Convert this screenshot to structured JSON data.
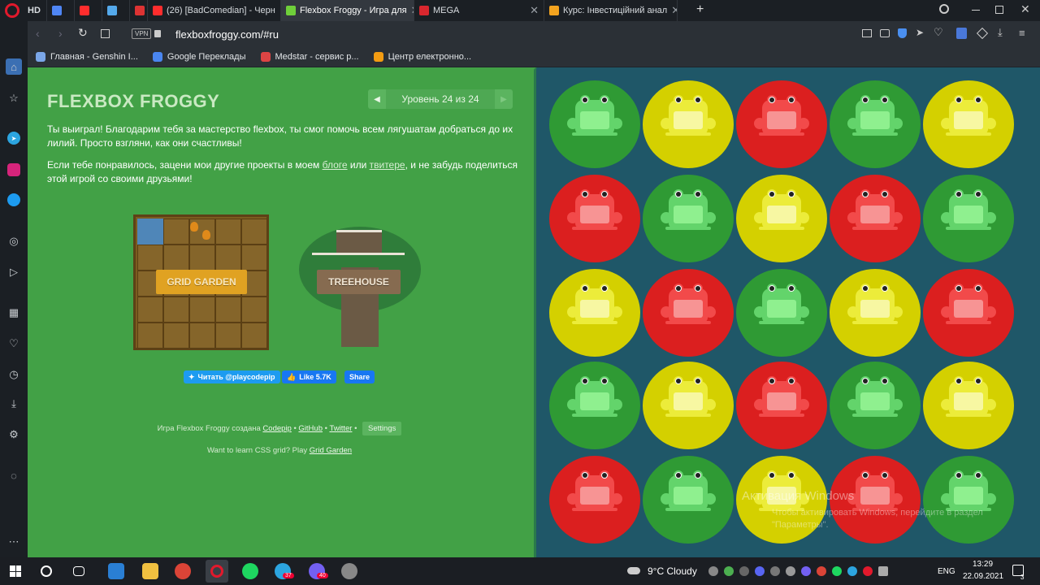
{
  "browser": {
    "tabs": [
      {
        "label": "HD",
        "color": "#3c3c3c"
      },
      {
        "label": "",
        "color": "#4f86f5"
      },
      {
        "label": "",
        "color": "#ff2d2d"
      },
      {
        "label": "",
        "color": "#54a9eb"
      },
      {
        "label": "",
        "color": "#d33"
      },
      {
        "label": "(26) [BadComedian] - Черн",
        "color": "#ff2d2d"
      },
      {
        "label": "Flexbox Froggy - Игра для",
        "color": "#6fcf3a"
      },
      {
        "label": "MEGA",
        "color": "#d9272e"
      },
      {
        "label": "Курс: Інвестиційний анал",
        "color": "#f2a31f"
      }
    ],
    "new_tab": "+",
    "vpn_badge": "VPN",
    "url": "flexboxfroggy.com/#ru",
    "bookmarks": [
      {
        "label": "Главная - Genshin I...",
        "color": "#7aa6e8"
      },
      {
        "label": "Google Переклады",
        "color": "#4a86f0"
      },
      {
        "label": "Medstar - сервис р...",
        "color": "#d44"
      },
      {
        "label": "Центр електронно...",
        "color": "#f39c12"
      }
    ]
  },
  "page": {
    "title": "FLEXBOX FROGGY",
    "level": "Уровень 24 из 24",
    "win_text": "Ты выиграл! Благодарим тебя за мастерство flexbox, ты смог помочь всем лягушатам добраться до их лилий. Просто взгляни, как они счастливы!",
    "projects_text_1": "Если тебе понравилось, зацени мои другие проекты в моем ",
    "blog_link": "блоге",
    "projects_text_2": " или ",
    "twitter_link": "твитере",
    "projects_text_3": ", и не забудь поделиться этой игрой со своими друзьями!",
    "grid_garden_label": "GRID GARDEN",
    "treehouse_label": "TREEHOUSE",
    "follow_button": "Читать @playcodepip",
    "like_button": "Like 5.7K",
    "share_button": "Share",
    "footer_text": "Игра Flexbox Froggy создана ",
    "codepip_link": "Codepip",
    "github_link": "GitHub",
    "twitter_footer_link": "Twitter",
    "settings_button": "Settings",
    "grid_promo_text": "Want to learn CSS grid? Play ",
    "grid_promo_link": "Grid Garden",
    "separator": "•"
  },
  "pond": {
    "rows": [
      [
        "green",
        "yellow",
        "red",
        "green",
        "yellow"
      ],
      [
        "red",
        "green",
        "yellow",
        "red",
        "green"
      ],
      [
        "yellow",
        "red",
        "green",
        "yellow",
        "red"
      ],
      [
        "green",
        "yellow",
        "red",
        "green",
        "yellow"
      ],
      [
        "red",
        "green",
        "yellow",
        "red",
        "green"
      ]
    ],
    "colors": {
      "green": {
        "pad": "#2f9a34",
        "frog": "#63d46b",
        "belly": "#8ff08f"
      },
      "yellow": {
        "pad": "#d4d000",
        "frog": "#ecec3a",
        "belly": "#f7f7a2"
      },
      "red": {
        "pad": "#db1f1f",
        "frog": "#f24a4a",
        "belly": "#f79494"
      }
    }
  },
  "watermark": {
    "title": "Активация Windows",
    "line1": "Чтобы активировать Windows, перейдите в раздел",
    "line2": "\"Параметры\"."
  },
  "taskbar": {
    "weather": "9°C  Cloudy",
    "lang": "ENG",
    "time": "13:29",
    "date": "22.09.2021",
    "telegram_badge": "37",
    "viber_badge": "40",
    "notif_count": "3"
  }
}
